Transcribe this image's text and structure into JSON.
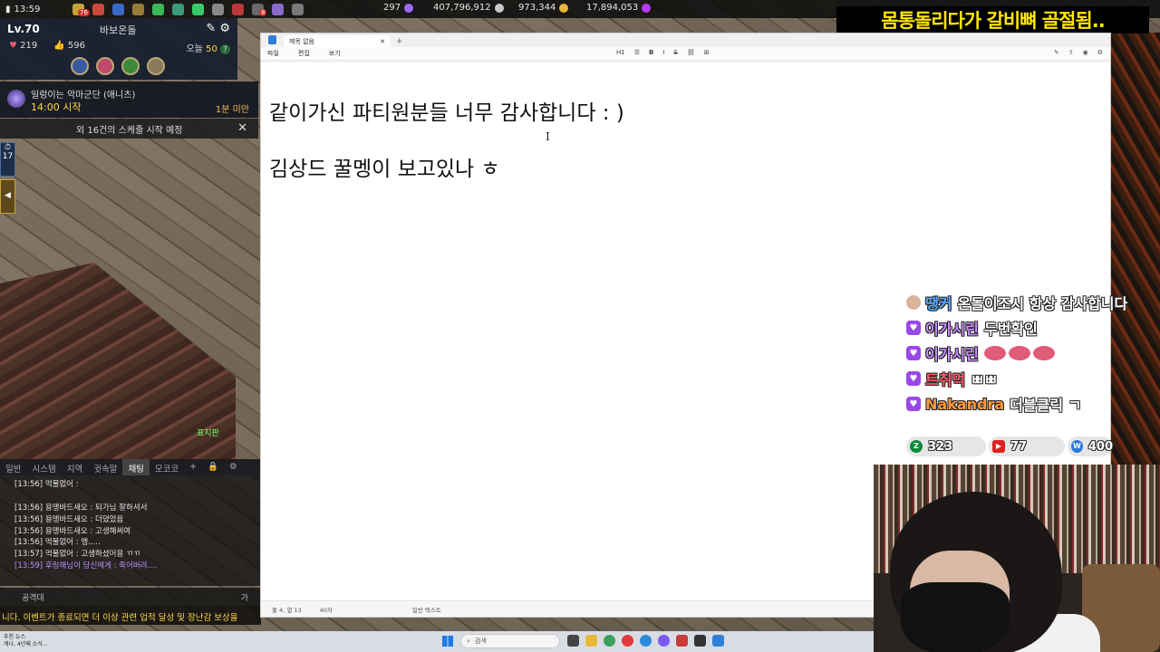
{
  "topbar": {
    "time": "13:59",
    "badge_76": "76",
    "badge_8": "8",
    "currency_1": "297",
    "currency_2": "407,796,912",
    "currency_3": "973,344",
    "currency_4": "17,894,053"
  },
  "banner": {
    "text": "몸통돌리다가 갈비뼈 골절됨.."
  },
  "character": {
    "level": "Lv.70",
    "name": "바보온돌",
    "hearts": "219",
    "likes": "596",
    "today_label": "오늘",
    "today_value": "50",
    "help": "?"
  },
  "event": {
    "title": "일렁이는 악마군단 (애니츠)",
    "time": "14:00 시작",
    "remaining": "1분 미만"
  },
  "schedule": {
    "text": "외 16건의 스케줄 시작 예정",
    "close": "✕"
  },
  "side_buttons": {
    "timer": "17"
  },
  "map_label": "표지판",
  "game_chat": {
    "tabs": [
      "일반",
      "시스템",
      "지역",
      "귓속말",
      "채팅",
      "모코코",
      "+"
    ],
    "active_tab": "채팅",
    "lines": [
      "[13:56] 먹물없어 :",
      "[13:56] 용맹바드새오 : 되가님 잘하셔서",
      "[13:56] 용맹바드새오 : 더뎠었음",
      "[13:56] 용맹바드새오 : 고생해써여",
      "[13:56] 먹물없어 : 엥.....",
      "[13:57] 먹물없어 : 고생하셨어용 ㄲㄲ",
      "[13:59] 후링해님이 당신에게 : 죽어버려...."
    ],
    "bottom_label": "공격대",
    "bottom_right": "가",
    "ticker": "니다. 이벤트가 종료되면 더 이상 관련 업적 달성 및 장난감 보상을"
  },
  "notepad": {
    "tab_title": "제목 없음",
    "menu": [
      "파일",
      "편집",
      "보기"
    ],
    "toolbar": [
      "H1",
      "☰",
      "B",
      "I",
      "S",
      "⛓",
      "⊞"
    ],
    "lines": [
      "같이가신 파티원분들 너무 감사합니다 : )",
      "김상드 꿀멩이 보고있나 ㅎ"
    ],
    "status_position": "줄 4, 열 13",
    "status_chars": "40자",
    "status_format": "일반 텍스트"
  },
  "stream_chat": [
    {
      "user": "땡커",
      "text": "온돌이조시 항상 감사합니다",
      "color": "#5aa8ff",
      "badge": "round"
    },
    {
      "user": "이가시린",
      "text": "두번확인",
      "color": "#c98cff",
      "badge": "heart"
    },
    {
      "user": "이가시린",
      "text": "",
      "color": "#c98cff",
      "badge": "heart",
      "emotes": 3
    },
    {
      "user": "트취먹",
      "text": "ㅃㅃ",
      "color": "#ff5a6a",
      "badge": "heart"
    },
    {
      "user": "Nakandra",
      "text": "더블클릭 ㄱ",
      "color": "#ff9a3c",
      "badge": "heart"
    }
  ],
  "viewers": {
    "chzzk": "323",
    "youtube": "77",
    "we": "400"
  },
  "taskbar": {
    "news_title": "추천 뉴스",
    "news_sub": "캐나, 4년째 소식...",
    "search_placeholder": "검색"
  }
}
